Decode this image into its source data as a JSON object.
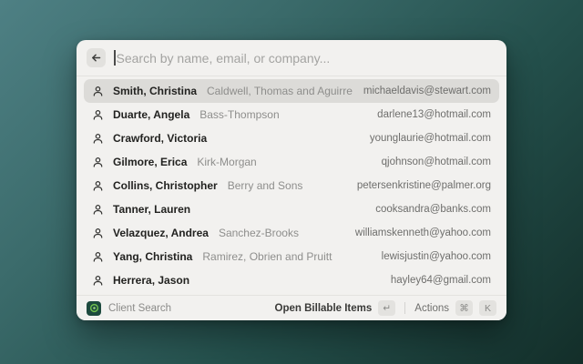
{
  "window": {
    "search": {
      "placeholder": "Search by name, email, or company...",
      "value": ""
    },
    "results": [
      {
        "name": "Smith, Christina",
        "company": "Caldwell, Thomas and Aguirre",
        "email": "michaeldavis@stewart.com",
        "selected": true
      },
      {
        "name": "Duarte, Angela",
        "company": "Bass-Thompson",
        "email": "darlene13@hotmail.com",
        "selected": false
      },
      {
        "name": "Crawford, Victoria",
        "company": "",
        "email": "younglaurie@hotmail.com",
        "selected": false
      },
      {
        "name": "Gilmore, Erica",
        "company": "Kirk-Morgan",
        "email": "qjohnson@hotmail.com",
        "selected": false
      },
      {
        "name": "Collins, Christopher",
        "company": "Berry and Sons",
        "email": "petersenkristine@palmer.org",
        "selected": false
      },
      {
        "name": "Tanner, Lauren",
        "company": "",
        "email": "cooksandra@banks.com",
        "selected": false
      },
      {
        "name": "Velazquez, Andrea",
        "company": "Sanchez-Brooks",
        "email": "williamskenneth@yahoo.com",
        "selected": false
      },
      {
        "name": "Yang, Christina",
        "company": "Ramirez, Obrien and Pruitt",
        "email": "lewisjustin@yahoo.com",
        "selected": false
      },
      {
        "name": "Herrera, Jason",
        "company": "",
        "email": "hayley64@gmail.com",
        "selected": false
      }
    ],
    "footer": {
      "app_name": "Client Search",
      "primary_action": "Open Billable Items",
      "primary_key": "↵",
      "actions_label": "Actions",
      "actions_keys": [
        "⌘",
        "K"
      ]
    }
  },
  "colors": {
    "desktop_gradient_start": "#4e8084",
    "desktop_gradient_end": "#132e29",
    "window_bg": "#f2f1ef",
    "selected_row_bg": "#dcdbd8",
    "logo_bg": "#1d4a3e",
    "logo_accent": "#6fbf4e"
  }
}
